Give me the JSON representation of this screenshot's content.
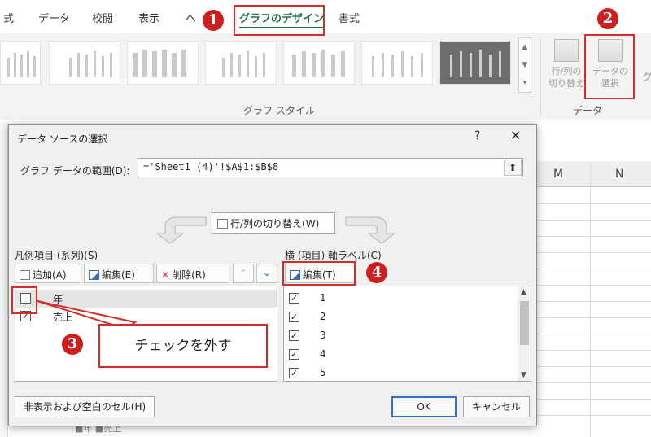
{
  "ribbon": {
    "tabs": [
      {
        "label": "式",
        "active": false
      },
      {
        "label": "データ",
        "active": false
      },
      {
        "label": "校閲",
        "active": false
      },
      {
        "label": "表示",
        "active": false
      },
      {
        "label": "ヘ",
        "active": false
      },
      {
        "label": "グラフのデザイン",
        "active": true
      },
      {
        "label": "書式",
        "active": false
      }
    ],
    "chart_styles_label": "グラフ スタイル",
    "data_group_label": "データ",
    "switch_row_col_line1": "行/列の",
    "switch_row_col_line2": "切り替え",
    "select_data_line1": "データの",
    "select_data_line2": "選択",
    "cut_off_char": "グ"
  },
  "sheet": {
    "column_m": "M",
    "column_n": "N",
    "legend_text": "■年 ■売上"
  },
  "dialog": {
    "title": "データ ソースの選択",
    "help": "?",
    "close": "✕",
    "range_label": "グラフ データの範囲(D):",
    "range_value": "='Sheet1 (4)'!$A$1:$B$8",
    "switch_button": "行/列の切り替え(W)",
    "series_label": "凡例項目 (系列)(S)",
    "add_button": "追加(A)",
    "edit_button": "編集(E)",
    "delete_button": "削除(R)",
    "series": [
      {
        "label": "年",
        "checked": false
      },
      {
        "label": "売上",
        "checked": true
      }
    ],
    "axis_label": "横 (項目) 軸ラベル(C)",
    "axis_edit_button": "編集(T)",
    "axis_items": [
      {
        "label": "1",
        "checked": true
      },
      {
        "label": "2",
        "checked": true
      },
      {
        "label": "3",
        "checked": true
      },
      {
        "label": "4",
        "checked": true
      },
      {
        "label": "5",
        "checked": true
      }
    ],
    "hidden_cells_button": "非表示および空白のセル(H)",
    "ok_button": "OK",
    "cancel_button": "キャンセル"
  },
  "annotations": {
    "badge1": "1",
    "badge2": "2",
    "badge3": "3",
    "badge4": "4",
    "note": "チェックを外す",
    "accent_color": "#d42b2b"
  }
}
